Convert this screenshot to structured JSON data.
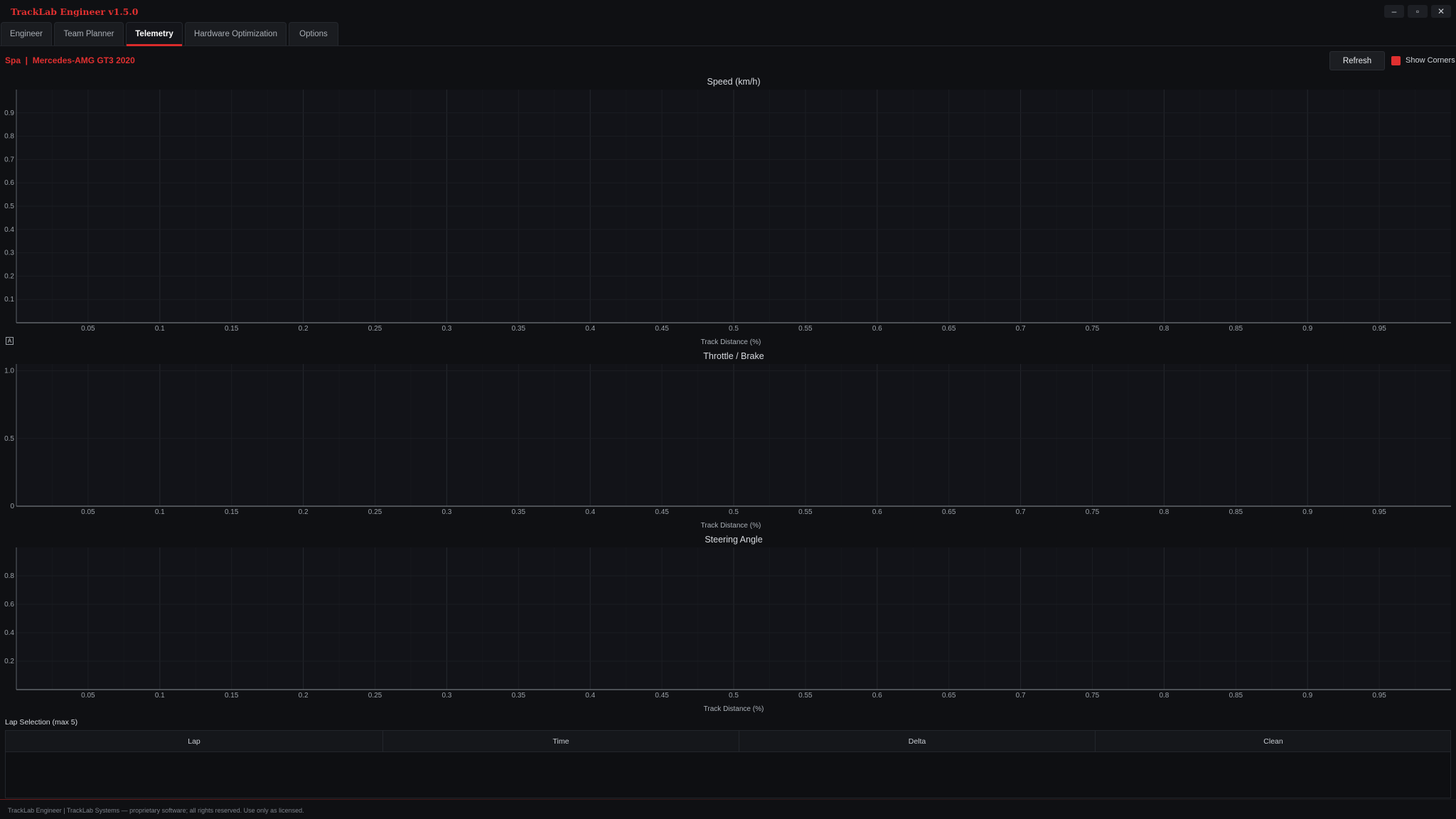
{
  "app": {
    "title": "TrackLab Engineer v1.5.0"
  },
  "window_controls": {
    "minimize": "–",
    "maximize": "▫",
    "close": "✕"
  },
  "tabs": [
    {
      "label": "Engineer",
      "active": false
    },
    {
      "label": "Team Planner",
      "active": false
    },
    {
      "label": "Telemetry",
      "active": true
    },
    {
      "label": "Hardware Optimization",
      "active": false
    },
    {
      "label": "Options",
      "active": false
    }
  ],
  "session": {
    "label": "Spa  |  Mercedes-AMG GT3 2020"
  },
  "toolbar": {
    "refresh_label": "Refresh",
    "show_corners_label": "Show Corners",
    "show_corners_checked": true
  },
  "charts": [
    {
      "title": "Speed (km/h)",
      "xlabel": "Track Distance (%)",
      "y_ticks": [
        "0.1",
        "0.2",
        "0.3",
        "0.4",
        "0.5",
        "0.6",
        "0.7",
        "0.8",
        "0.9"
      ]
    },
    {
      "title": "Throttle / Brake",
      "xlabel": "Track Distance (%)",
      "y_ticks": [
        "0",
        "0.5",
        "1.0"
      ]
    },
    {
      "title": "Steering Angle",
      "xlabel": "Track Distance (%)",
      "y_ticks": [
        "0.2",
        "0.4",
        "0.6",
        "0.8"
      ]
    }
  ],
  "chart_data": [
    {
      "type": "line",
      "title": "Speed (km/h)",
      "xlabel": "Track Distance (%)",
      "ylabel": "",
      "xlim": [
        0,
        1
      ],
      "ylim": [
        0,
        1
      ],
      "series": [],
      "grid": true,
      "x_ticks": [
        "0.05",
        "0.1",
        "0.15",
        "0.2",
        "0.25",
        "0.3",
        "0.35",
        "0.4",
        "0.45",
        "0.5",
        "0.55",
        "0.6",
        "0.65",
        "0.7",
        "0.75",
        "0.8",
        "0.85",
        "0.9",
        "0.95"
      ]
    },
    {
      "type": "line",
      "title": "Throttle / Brake",
      "xlabel": "Track Distance (%)",
      "ylabel": "",
      "xlim": [
        0,
        1
      ],
      "ylim": [
        0,
        1.05
      ],
      "series": [],
      "grid": true,
      "x_ticks": [
        "0.05",
        "0.1",
        "0.15",
        "0.2",
        "0.25",
        "0.3",
        "0.35",
        "0.4",
        "0.45",
        "0.5",
        "0.55",
        "0.6",
        "0.65",
        "0.7",
        "0.75",
        "0.8",
        "0.85",
        "0.9",
        "0.95"
      ]
    },
    {
      "type": "line",
      "title": "Steering Angle",
      "xlabel": "Track Distance (%)",
      "ylabel": "",
      "xlim": [
        0,
        1
      ],
      "ylim": [
        0,
        1
      ],
      "series": [],
      "grid": true,
      "x_ticks": [
        "0.05",
        "0.1",
        "0.15",
        "0.2",
        "0.25",
        "0.3",
        "0.35",
        "0.4",
        "0.45",
        "0.5",
        "0.55",
        "0.6",
        "0.65",
        "0.7",
        "0.75",
        "0.8",
        "0.85",
        "0.9",
        "0.95"
      ]
    }
  ],
  "lap_selection": {
    "title": "Lap Selection (max 5)",
    "columns": [
      "Lap",
      "Time",
      "Delta",
      "Clean"
    ],
    "rows": []
  },
  "footer": {
    "text": "TrackLab Engineer | TrackLab Systems — proprietary software; all rights reserved. Use only as licensed."
  },
  "colors": {
    "accent": "#e03030",
    "background": "#0f1013",
    "plot_bg": "#121318",
    "grid": "#1e2026"
  }
}
